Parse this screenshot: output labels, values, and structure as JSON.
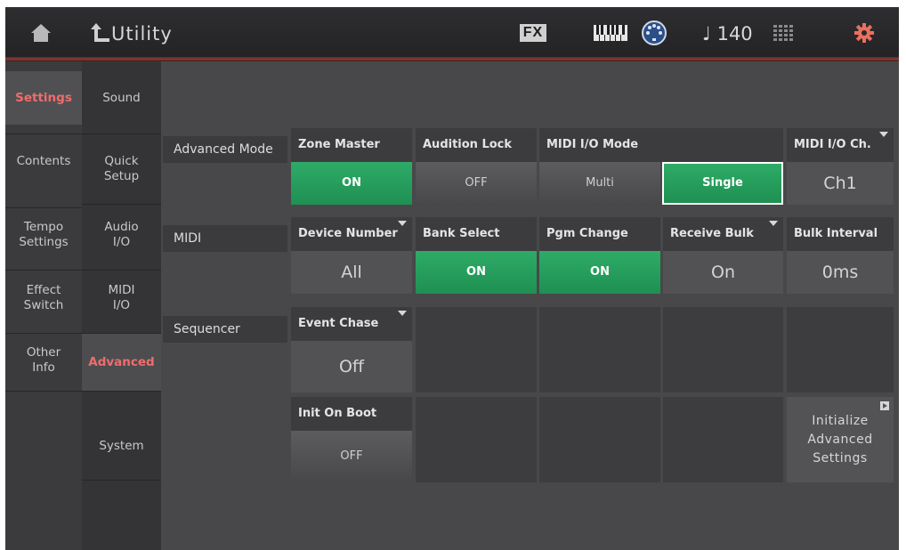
{
  "header": {
    "title": "Utility",
    "fx_label": "FX",
    "tempo": "♩ 140",
    "icons": [
      "home-icon",
      "back-arrow-icon",
      "keyboard-icon",
      "midi-icon",
      "grid-icon",
      "gear-icon"
    ],
    "accent_color": "#ee6d6d"
  },
  "sidebar": {
    "primary": [
      {
        "label": "Settings",
        "selected": true
      },
      {
        "label": "Contents"
      },
      {
        "label": "Tempo\nSettings"
      },
      {
        "label": "Effect\nSwitch"
      },
      {
        "label": "Other\nInfo"
      }
    ],
    "secondary": [
      {
        "label": "Sound"
      },
      {
        "label": "Quick\nSetup"
      },
      {
        "label": "Audio\nI/O"
      },
      {
        "label": "MIDI\nI/O"
      },
      {
        "label": "Advanced",
        "selected": true
      },
      {
        "label": "System"
      }
    ]
  },
  "rows": {
    "advanced_mode": "Advanced Mode",
    "midi": "MIDI",
    "sequencer": "Sequencer"
  },
  "params": {
    "zone_master": {
      "label": "Zone Master",
      "value": "ON"
    },
    "audition_lock": {
      "label": "Audition Lock",
      "value": "OFF"
    },
    "midi_io_mode": {
      "label": "MIDI I/O Mode",
      "options": [
        "Multi",
        "Single"
      ],
      "selected": "Single"
    },
    "midi_io_ch": {
      "label": "MIDI I/O Ch.",
      "value": "Ch1"
    },
    "device_number": {
      "label": "Device Number",
      "value": "All"
    },
    "bank_select": {
      "label": "Bank Select",
      "value": "ON"
    },
    "pgm_change": {
      "label": "Pgm Change",
      "value": "ON"
    },
    "receive_bulk": {
      "label": "Receive Bulk",
      "value": "On"
    },
    "bulk_interval": {
      "label": "Bulk Interval",
      "value": "0ms"
    },
    "event_chase": {
      "label": "Event Chase",
      "value": "Off"
    },
    "init_on_boot": {
      "label": "Init On Boot",
      "value": "OFF"
    }
  },
  "initialize_button": {
    "label": "Initialize\nAdvanced\nSettings"
  },
  "colors": {
    "on_green": "#28a060",
    "selected_text": "#ee6d6d",
    "background": "#48484a"
  }
}
